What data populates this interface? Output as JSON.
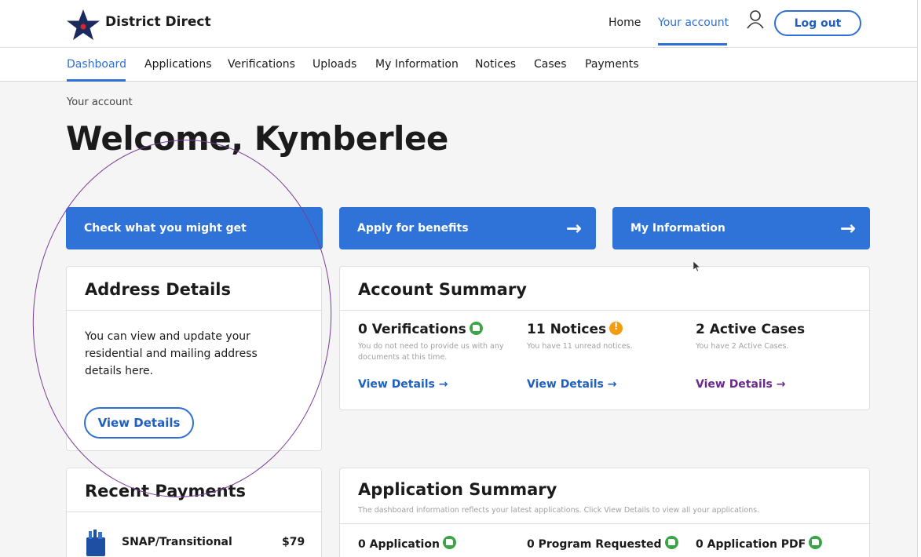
{
  "header": {
    "brand": "District Direct",
    "nav_home": "Home",
    "nav_account": "Your account",
    "logout_label": "Log out"
  },
  "tabs": [
    "Dashboard",
    "Applications",
    "Verifications",
    "Uploads",
    "My Information",
    "Notices",
    "Cases",
    "Payments"
  ],
  "breadcrumb": "Your account",
  "page_title": "Welcome, Kymberlee",
  "actions": {
    "check": "Check what you might get",
    "apply": "Apply for benefits",
    "myinfo": "My Information"
  },
  "address_card": {
    "title": "Address Details",
    "text": "You can view and update your residential and mailing address details here.",
    "button": "View Details"
  },
  "account_summary": {
    "title": "Account Summary",
    "items": [
      {
        "heading": "0 Verifications",
        "sub": "You do not need to provide us with any documents at this time.",
        "link": "View Details →",
        "link_color": "#1f5fbf"
      },
      {
        "heading": "11 Notices",
        "sub": "You have 11 unread notices.",
        "link": "View Details →",
        "link_color": "#1f5fbf"
      },
      {
        "heading": "2 Active Cases",
        "sub": "You have 2 Active Cases.",
        "link": "View Details →",
        "link_color": "#6a2a8c"
      }
    ]
  },
  "payments_card": {
    "title": "Recent Payments",
    "item_label": "SNAP/Transitional",
    "item_amount": "$79"
  },
  "application_summary": {
    "title": "Application Summary",
    "sub": "The dashboard information reflects your latest applications. Click View Details to view all your applications.",
    "items": [
      "0 Application",
      "0 Program Requested",
      "0 Application PDF"
    ]
  },
  "colors": {
    "primary": "#2f73d9",
    "success": "#3aa547",
    "warning": "#f39c12",
    "annotation": "#7a3d9a"
  }
}
